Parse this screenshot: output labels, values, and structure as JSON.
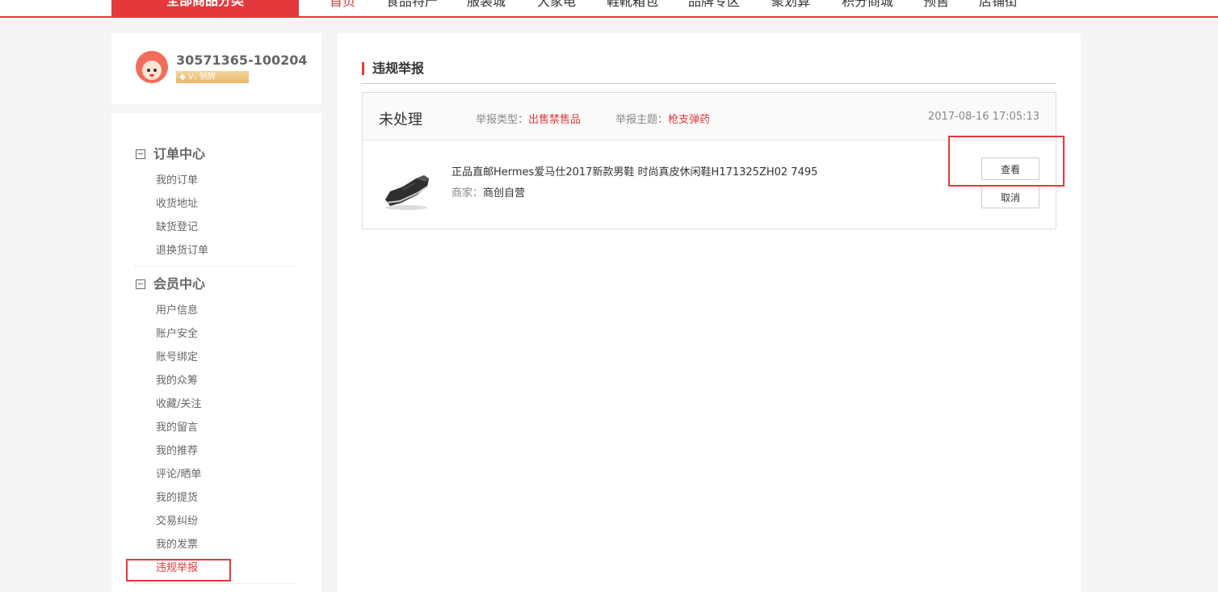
{
  "nav": {
    "all_categories": "全部商品分类",
    "items": [
      "首页",
      "食品特产",
      "服装城",
      "大家电",
      "鞋靴箱包",
      "品牌专区",
      "聚划算",
      "积分商城",
      "预售",
      "店铺街"
    ]
  },
  "profile": {
    "username": "30571365-100204",
    "level_prefix": "V₁",
    "level": "铜牌"
  },
  "sidebar": {
    "sections": [
      {
        "title": "订单中心",
        "items": [
          "我的订单",
          "收货地址",
          "缺货登记",
          "退换货订单"
        ]
      },
      {
        "title": "会员中心",
        "items": [
          "用户信息",
          "账户安全",
          "账号绑定",
          "我的众筹",
          "收藏/关注",
          "我的留言",
          "我的推荐",
          "评论/晒单",
          "我的提货",
          "交易纠纷",
          "我的发票",
          "违规举报"
        ]
      }
    ],
    "active_item": "违规举报"
  },
  "main": {
    "page_title": "违规举报",
    "report": {
      "status": "未处理",
      "type_label": "举报类型：",
      "type_value": "出售禁售品",
      "subject_label": "举报主题：",
      "subject_value": "枪支弹药",
      "datetime": "2017-08-16 17:05:13",
      "product_title": "正品直邮Hermes爱马仕2017新款男鞋 时尚真皮休闲鞋H171325ZH02 7495",
      "seller_label": "商家：",
      "seller_value": "商创自营",
      "view_label": "查看",
      "cancel_label": "取消"
    }
  },
  "colors": {
    "accent": "#e4393c"
  }
}
